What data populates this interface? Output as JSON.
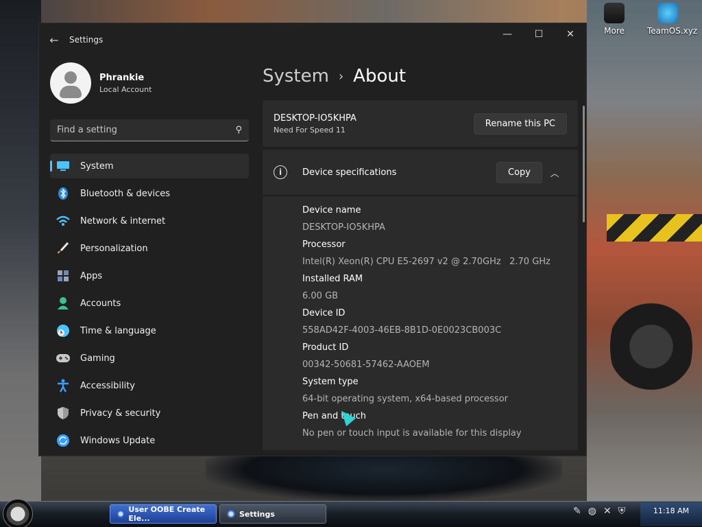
{
  "desktop": {
    "icons": [
      {
        "label": "More"
      },
      {
        "label": "TeamOS.xyz"
      }
    ]
  },
  "window": {
    "title": "Settings",
    "controls": {
      "minimize": "—",
      "maximize": "☐",
      "close": "✕"
    }
  },
  "profile": {
    "name": "Phrankie",
    "account_type": "Local Account"
  },
  "search": {
    "placeholder": "Find a setting"
  },
  "sidebar": {
    "items": [
      {
        "label": "System",
        "icon": "monitor-icon",
        "color": "#4cc2ff"
      },
      {
        "label": "Bluetooth & devices",
        "icon": "bluetooth-icon",
        "color": "#2b88d8"
      },
      {
        "label": "Network & internet",
        "icon": "wifi-icon",
        "color": "#4cc2ff"
      },
      {
        "label": "Personalization",
        "icon": "brush-icon",
        "color": "#f0a35a"
      },
      {
        "label": "Apps",
        "icon": "apps-icon",
        "color": "#9aa5b8"
      },
      {
        "label": "Accounts",
        "icon": "person-icon",
        "color": "#3cc28a"
      },
      {
        "label": "Time & language",
        "icon": "globe-clock-icon",
        "color": "#4cc2ff"
      },
      {
        "label": "Gaming",
        "icon": "gamepad-icon",
        "color": "#c8c8c8"
      },
      {
        "label": "Accessibility",
        "icon": "accessibility-icon",
        "color": "#3aa0ff"
      },
      {
        "label": "Privacy & security",
        "icon": "shield-icon",
        "color": "#9a9a9a"
      },
      {
        "label": "Windows Update",
        "icon": "update-icon",
        "color": "#3aa0ff"
      }
    ]
  },
  "main": {
    "breadcrumb": {
      "parent": "System",
      "separator": "›",
      "current": "About"
    },
    "pc": {
      "name": "DESKTOP-IO5KHPA",
      "model": "Need For Speed 11",
      "rename_label": "Rename this PC"
    },
    "specs": {
      "title": "Device specifications",
      "copy_label": "Copy",
      "rows": [
        {
          "label": "Device name",
          "value": "DESKTOP-IO5KHPA"
        },
        {
          "label": "Processor",
          "value": "Intel(R) Xeon(R) CPU E5-2697 v2 @ 2.70GHz   2.70 GHz"
        },
        {
          "label": "Installed RAM",
          "value": "6.00 GB"
        },
        {
          "label": "Device ID",
          "value": "558AD42F-4003-46EB-8B1D-0E0023CB003C"
        },
        {
          "label": "Product ID",
          "value": "00342-50681-57462-AAOEM"
        },
        {
          "label": "System type",
          "value": "64-bit operating system, x64-based processor"
        },
        {
          "label": "Pen and touch",
          "value": "No pen or touch input is available for this display"
        }
      ]
    }
  },
  "taskbar": {
    "tasks": [
      {
        "label": "User OOBE Create Ele..."
      },
      {
        "label": "Settings"
      }
    ],
    "clock": "11:18 AM"
  },
  "colors": {
    "accent": "#4cc2ff",
    "window_bg": "#202020",
    "card_bg": "#2b2b2b"
  }
}
